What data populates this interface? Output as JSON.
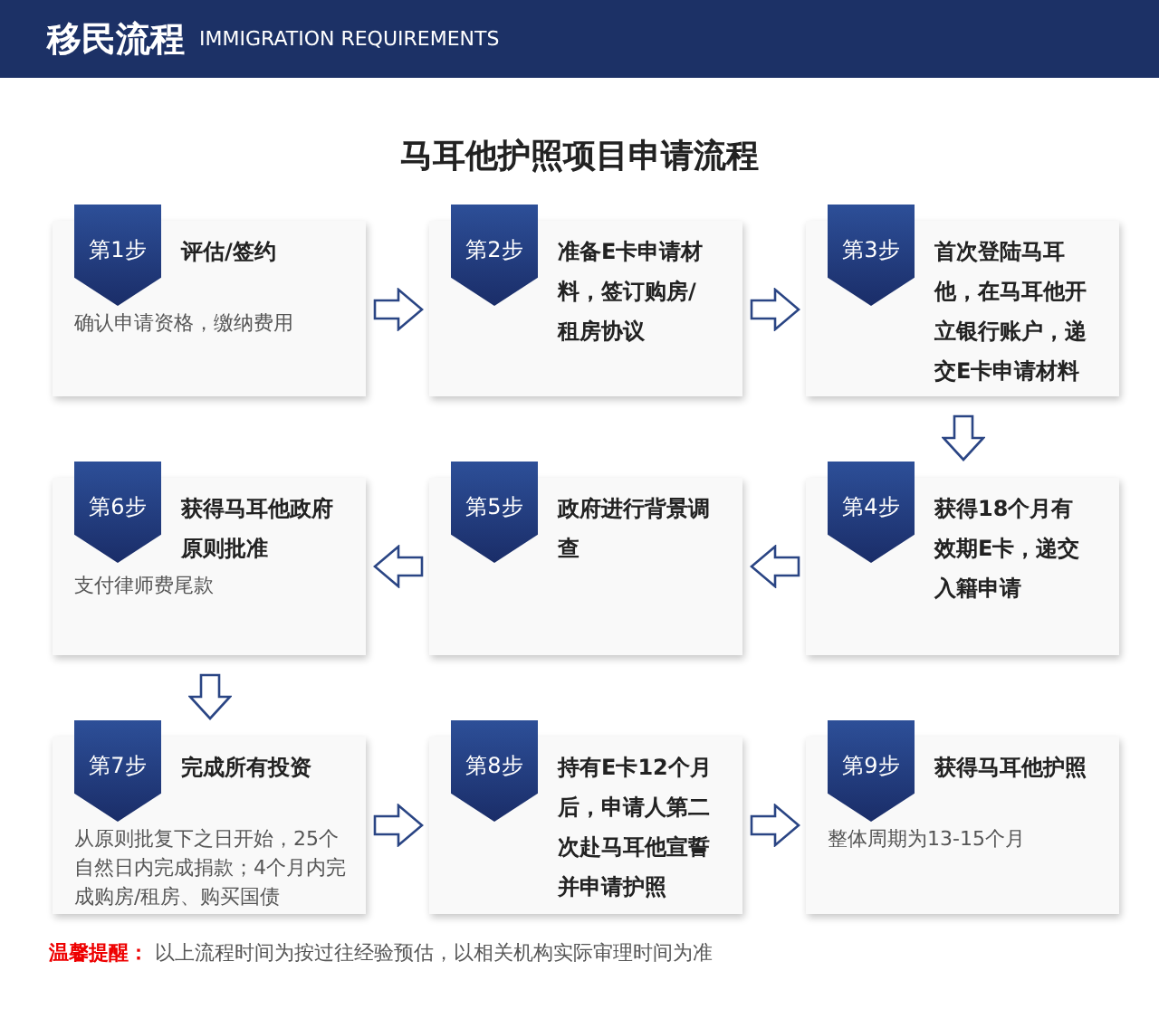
{
  "header": {
    "title": "移民流程",
    "subtitle": "IMMIGRATION REQUIREMENTS"
  },
  "heading": "马耳他护照项目申请流程",
  "rows": [
    {
      "reversed": false,
      "steps": [
        {
          "badge": "第1步",
          "title": "评估/签约",
          "description": "确认申请资格，缴纳费用"
        },
        {
          "badge": "第2步",
          "title": "准备E卡申请材料，签订购房/租房协议"
        },
        {
          "badge": "第3步",
          "title": "首次登陆马耳他，在马耳他开立银行账户，递交E卡申请材料"
        }
      ]
    },
    {
      "reversed": true,
      "steps": [
        {
          "badge": "第6步",
          "title": "获得马耳他政府原则批准",
          "description": "支付律师费尾款"
        },
        {
          "badge": "第5步",
          "title": "政府进行背景调查"
        },
        {
          "badge": "第4步",
          "title": "获得18个月有效期E卡，递交入籍申请"
        }
      ]
    },
    {
      "reversed": false,
      "steps": [
        {
          "badge": "第7步",
          "title": "完成所有投资",
          "description": "从原则批复下之日开始，25个自然日内完成捐款；4个月内完成购房/租房、购买国债"
        },
        {
          "badge": "第8步",
          "title": "持有E卡12个月后，申请人第二次赴马耳他宣誓并申请护照"
        },
        {
          "badge": "第9步",
          "title": "获得马耳他护照",
          "description": "整体周期为13-15个月"
        }
      ]
    }
  ],
  "notice": {
    "label": "温馨提醒：",
    "text": "以上流程时间为按过往经验预估，以相关机构实际审理时间为准"
  }
}
